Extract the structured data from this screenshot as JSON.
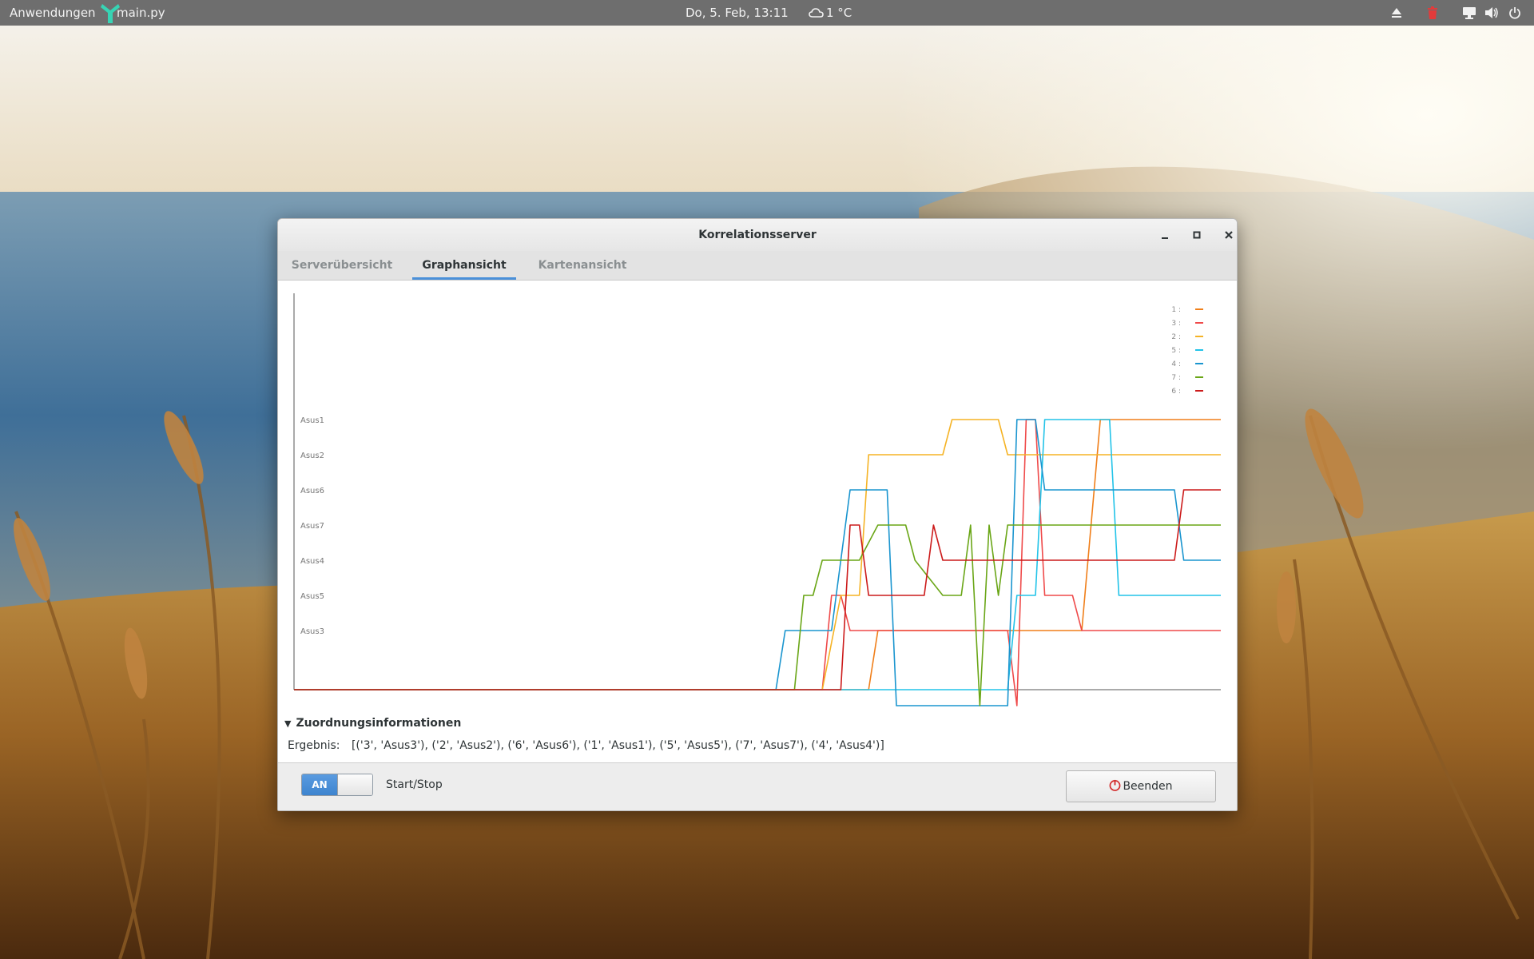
{
  "topbar": {
    "activities": "Anwendungen",
    "app_name": "main.py",
    "clock": "Do,  5. Feb, 13:11",
    "weather": "1 °C",
    "icons": [
      "eject-icon",
      "trash-icon",
      "network-icon",
      "volume-icon",
      "power-icon"
    ]
  },
  "window": {
    "title": "Korrelationsserver",
    "controls": [
      "minimize-icon",
      "maximize-icon",
      "close-icon"
    ],
    "tabs": [
      {
        "label": "Serverübersicht",
        "active": false
      },
      {
        "label": "Graphansicht",
        "active": true
      },
      {
        "label": "Kartenansicht",
        "active": false
      }
    ]
  },
  "chart_data": {
    "type": "line",
    "title": "",
    "xlabel": "",
    "ylabel": "",
    "y_categories": [
      "Asus1",
      "Asus2",
      "Asus6",
      "Asus7",
      "Asus4",
      "Asus5",
      "Asus3"
    ],
    "x": [
      0,
      10,
      20,
      30,
      40,
      50,
      55,
      60,
      62,
      64,
      66,
      68,
      70,
      72,
      74,
      76,
      78,
      80,
      82,
      84,
      86,
      88,
      90,
      92,
      94,
      96,
      98,
      100
    ],
    "legend": [
      "1 :",
      "3 :",
      "2 :",
      "5 :",
      "4 :",
      "7 :",
      "6 :"
    ],
    "series": [
      {
        "name": "1 :",
        "color": "#f07f1a",
        "points": [
          [
            0,
            "none"
          ],
          [
            62,
            "none"
          ],
          [
            63,
            "Asus3"
          ],
          [
            85,
            "Asus3"
          ],
          [
            87,
            "Asus1"
          ],
          [
            100,
            "Asus1"
          ]
        ]
      },
      {
        "name": "3 :",
        "color": "#ef4a4a",
        "points": [
          [
            0,
            "none"
          ],
          [
            57,
            "none"
          ],
          [
            58,
            "Asus5"
          ],
          [
            59,
            "Asus5"
          ],
          [
            60,
            "Asus3"
          ],
          [
            77,
            "Asus3"
          ],
          [
            78,
            "off"
          ],
          [
            79,
            "Asus1"
          ],
          [
            80,
            "Asus1"
          ],
          [
            81,
            "Asus5"
          ],
          [
            84,
            "Asus5"
          ],
          [
            85,
            "Asus3"
          ],
          [
            100,
            "Asus3"
          ]
        ]
      },
      {
        "name": "2 :",
        "color": "#f5b325",
        "points": [
          [
            0,
            "none"
          ],
          [
            57,
            "none"
          ],
          [
            59,
            "Asus5"
          ],
          [
            61,
            "Asus5"
          ],
          [
            62,
            "Asus2"
          ],
          [
            70,
            "Asus2"
          ],
          [
            71,
            "Asus1"
          ],
          [
            76,
            "Asus1"
          ],
          [
            77,
            "Asus2"
          ],
          [
            100,
            "Asus2"
          ]
        ]
      },
      {
        "name": "5 :",
        "color": "#22c3e8",
        "points": [
          [
            0,
            "none"
          ],
          [
            60,
            "none"
          ],
          [
            77,
            "none"
          ],
          [
            78,
            "Asus5"
          ],
          [
            80,
            "Asus5"
          ],
          [
            81,
            "Asus1"
          ],
          [
            88,
            "Asus1"
          ],
          [
            89,
            "Asus5"
          ],
          [
            100,
            "Asus5"
          ]
        ]
      },
      {
        "name": "4 :",
        "color": "#1a95cf",
        "points": [
          [
            0,
            "none"
          ],
          [
            52,
            "none"
          ],
          [
            53,
            "Asus3"
          ],
          [
            58,
            "Asus3"
          ],
          [
            60,
            "Asus6"
          ],
          [
            64,
            "Asus6"
          ],
          [
            65,
            "off"
          ],
          [
            77,
            "off"
          ],
          [
            78,
            "Asus1"
          ],
          [
            80,
            "Asus1"
          ],
          [
            81,
            "Asus6"
          ],
          [
            95,
            "Asus6"
          ],
          [
            96,
            "Asus4"
          ],
          [
            100,
            "Asus4"
          ]
        ]
      },
      {
        "name": "7 :",
        "color": "#6aa617",
        "points": [
          [
            0,
            "none"
          ],
          [
            54,
            "none"
          ],
          [
            55,
            "Asus5"
          ],
          [
            56,
            "Asus5"
          ],
          [
            57,
            "Asus4"
          ],
          [
            61,
            "Asus4"
          ],
          [
            63,
            "Asus7"
          ],
          [
            66,
            "Asus7"
          ],
          [
            67,
            "Asus4"
          ],
          [
            70,
            "Asus5"
          ],
          [
            72,
            "Asus5"
          ],
          [
            73,
            "Asus7"
          ],
          [
            74,
            "off"
          ],
          [
            75,
            "Asus7"
          ],
          [
            76,
            "Asus5"
          ],
          [
            77,
            "Asus7"
          ],
          [
            100,
            "Asus7"
          ]
        ]
      },
      {
        "name": "6 :",
        "color": "#cc1b1b",
        "points": [
          [
            0,
            "none"
          ],
          [
            59,
            "none"
          ],
          [
            60,
            "Asus7"
          ],
          [
            61,
            "Asus7"
          ],
          [
            62,
            "Asus5"
          ],
          [
            68,
            "Asus5"
          ],
          [
            69,
            "Asus7"
          ],
          [
            70,
            "Asus4"
          ],
          [
            95,
            "Asus4"
          ],
          [
            96,
            "Asus6"
          ],
          [
            100,
            "Asus6"
          ]
        ]
      }
    ]
  },
  "assignment": {
    "expander_label": "Zuordnungsinformationen",
    "result_label": "Ergebnis:",
    "result_value": "[('3', 'Asus3'), ('2', 'Asus2'), ('6', 'Asus6'), ('1', 'Asus1'), ('5', 'Asus5'), ('7', 'Asus7'), ('4', 'Asus4')]"
  },
  "controls": {
    "switch_state": "AN",
    "switch_label": "Start/Stop",
    "quit_label": "Beenden",
    "quit_color": "#d32f2f",
    "accent": "#4a90d9"
  }
}
